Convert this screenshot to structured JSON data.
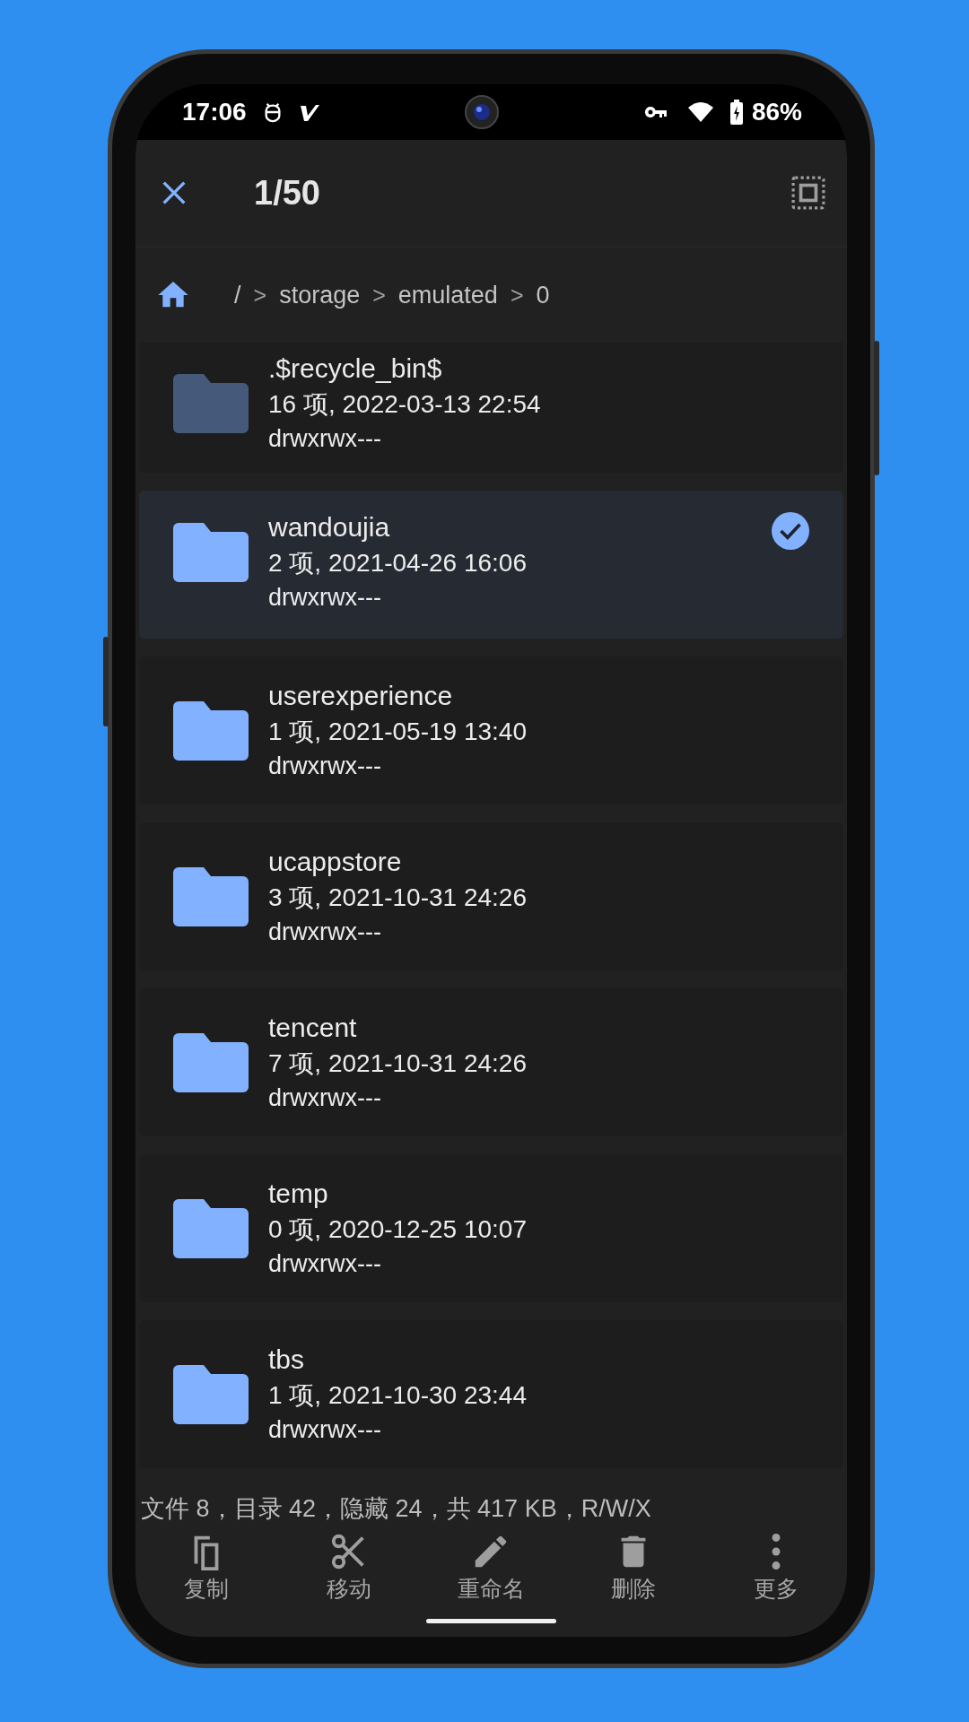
{
  "status_bar": {
    "time": "17:06",
    "battery": "86%"
  },
  "header": {
    "title": "1/50"
  },
  "breadcrumb": [
    {
      "kind": "segment",
      "text": "/"
    },
    {
      "kind": "separator",
      "text": ">"
    },
    {
      "kind": "segment",
      "text": "storage"
    },
    {
      "kind": "separator",
      "text": ">"
    },
    {
      "kind": "segment",
      "text": "emulated"
    },
    {
      "kind": "separator",
      "text": ">"
    },
    {
      "kind": "segment",
      "text": "0"
    }
  ],
  "files": [
    {
      "name": ".$recycle_bin$",
      "info": "16 项, 2022-03-13 22:54",
      "permissions": "drwxrwx---",
      "hidden": true,
      "selected": false
    },
    {
      "name": "wandoujia",
      "info": "2 项, 2021-04-26 16:06",
      "permissions": "drwxrwx---",
      "hidden": false,
      "selected": true
    },
    {
      "name": "userexperience",
      "info": "1 项, 2021-05-19 13:40",
      "permissions": "drwxrwx---",
      "hidden": false,
      "selected": false
    },
    {
      "name": "ucappstore",
      "info": "3 项, 2021-10-31 24:26",
      "permissions": "drwxrwx---",
      "hidden": false,
      "selected": false
    },
    {
      "name": "tencent",
      "info": "7 项, 2021-10-31 24:26",
      "permissions": "drwxrwx---",
      "hidden": false,
      "selected": false
    },
    {
      "name": "temp",
      "info": "0 项, 2020-12-25 10:07",
      "permissions": "drwxrwx---",
      "hidden": false,
      "selected": false
    },
    {
      "name": "tbs",
      "info": "1 项, 2021-10-30 23:44",
      "permissions": "drwxrwx---",
      "hidden": false,
      "selected": false
    }
  ],
  "summary": "文件 8，目录 42，隐藏 24，共 417 KB，R/W/X",
  "actions": [
    {
      "kind": "copy",
      "label": "复制"
    },
    {
      "kind": "cut",
      "label": "移动"
    },
    {
      "kind": "rename",
      "label": "重命名"
    },
    {
      "kind": "delete",
      "label": "删除"
    },
    {
      "kind": "more",
      "label": "更多"
    }
  ]
}
